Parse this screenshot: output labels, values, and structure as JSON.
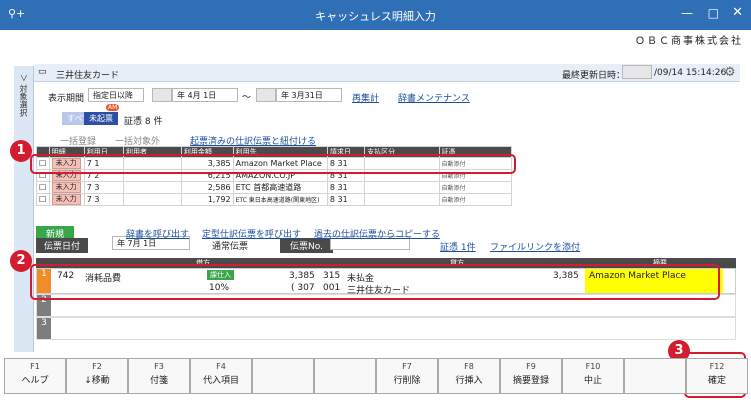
{
  "window": {
    "title": "キャッシュレス明細入力",
    "company": "ＯＢＣ商事株式会社",
    "side_label": "＞ 対象選択"
  },
  "panel": {
    "title": "三井住友カード",
    "last_update_label": "最終更新日時：",
    "last_update_value": "/09/14 15:14:26"
  },
  "filters": {
    "period_label": "表示期間",
    "period_mode": "指定日以降",
    "date_from": "年  4月  1日",
    "tilde": "〜",
    "date_to": "年  3月31日",
    "recalc": "再集計",
    "dict": "辞書メンテナンス"
  },
  "tabs": {
    "all": "すべて",
    "unregistered": "未起票",
    "badge": "AM",
    "count": "証憑 8 件"
  },
  "actions": {
    "bulk_register": "一括登録",
    "bulk_exclude": "一括対象外",
    "link": "起票済みの仕訳伝票と紐付ける"
  },
  "list": {
    "headers": [
      "",
      "明細",
      "利用日",
      "利用者",
      "利用金額",
      "利用先",
      "請求日",
      "支払区分",
      "証憑"
    ],
    "rows": [
      {
        "status": "未入力",
        "date": "7  1",
        "amount": "3,385",
        "payee": "Amazon Market Place",
        "bill": "8  31",
        "att": "自動添付"
      },
      {
        "status": "未入力",
        "date": "7  2",
        "amount": "6,215",
        "payee": "AMAZON.CO.JP",
        "bill": "8  31",
        "att": "自動添付"
      },
      {
        "status": "未入力",
        "date": "7  3",
        "amount": "2,586",
        "payee": "ETC 首都高速道路",
        "bill": "8  31",
        "att": "自動添付"
      },
      {
        "status": "未入力",
        "date": "7  3",
        "amount": "1,792",
        "payee": "ETC 東日本高速道路(関東地区)",
        "bill": "8  31",
        "att": "自動添付"
      }
    ]
  },
  "voucher": {
    "new_label": "新規",
    "date_label": "伝票日付",
    "date_value": "年  7月  1日",
    "type": "通常伝票",
    "no_label": "伝票No.",
    "call_slip": "辞書を呼び出す",
    "call_fixed": "定型仕訳伝票を呼び出す",
    "copy_past": "過去の仕訳伝票からコピーする",
    "evidence": "証憑 1件",
    "filelink": "ファイルリンクを添付"
  },
  "journal": {
    "debit_header": "借方",
    "credit_header": "貸方",
    "summary_header": "摘要",
    "row": {
      "no": "1",
      "code": "742",
      "account": "消耗品費",
      "tax_tag": "課仕入",
      "amount": "3,385",
      "tax_rate": "10%",
      "tax_amount": "( 307",
      "cr_code": "315",
      "cr_account": "未払金",
      "cr_sub_code": "001",
      "cr_sub": "三井住友カード",
      "cr_amount": "3,385",
      "summary": "Amazon Market Place"
    },
    "empty_rows": [
      "2",
      "3"
    ]
  },
  "fkeys": [
    {
      "n": "F1",
      "l": "ヘルプ"
    },
    {
      "n": "F2",
      "l": "↓移動"
    },
    {
      "n": "F3",
      "l": "付箋"
    },
    {
      "n": "F4",
      "l": "代入項目"
    },
    {
      "n": "",
      "l": ""
    },
    {
      "n": "",
      "l": ""
    },
    {
      "n": "F7",
      "l": "行削除"
    },
    {
      "n": "F8",
      "l": "行挿入"
    },
    {
      "n": "F9",
      "l": "摘要登録"
    },
    {
      "n": "F10",
      "l": "中止"
    },
    {
      "n": "",
      "l": ""
    },
    {
      "n": "F12",
      "l": "確定"
    }
  ],
  "callouts": [
    "1",
    "2",
    "3"
  ],
  "colors": {
    "title": "#2f6fb5",
    "callout": "#d31c30",
    "summary_bg": "#ffff00",
    "row_no": "#f28c28"
  }
}
